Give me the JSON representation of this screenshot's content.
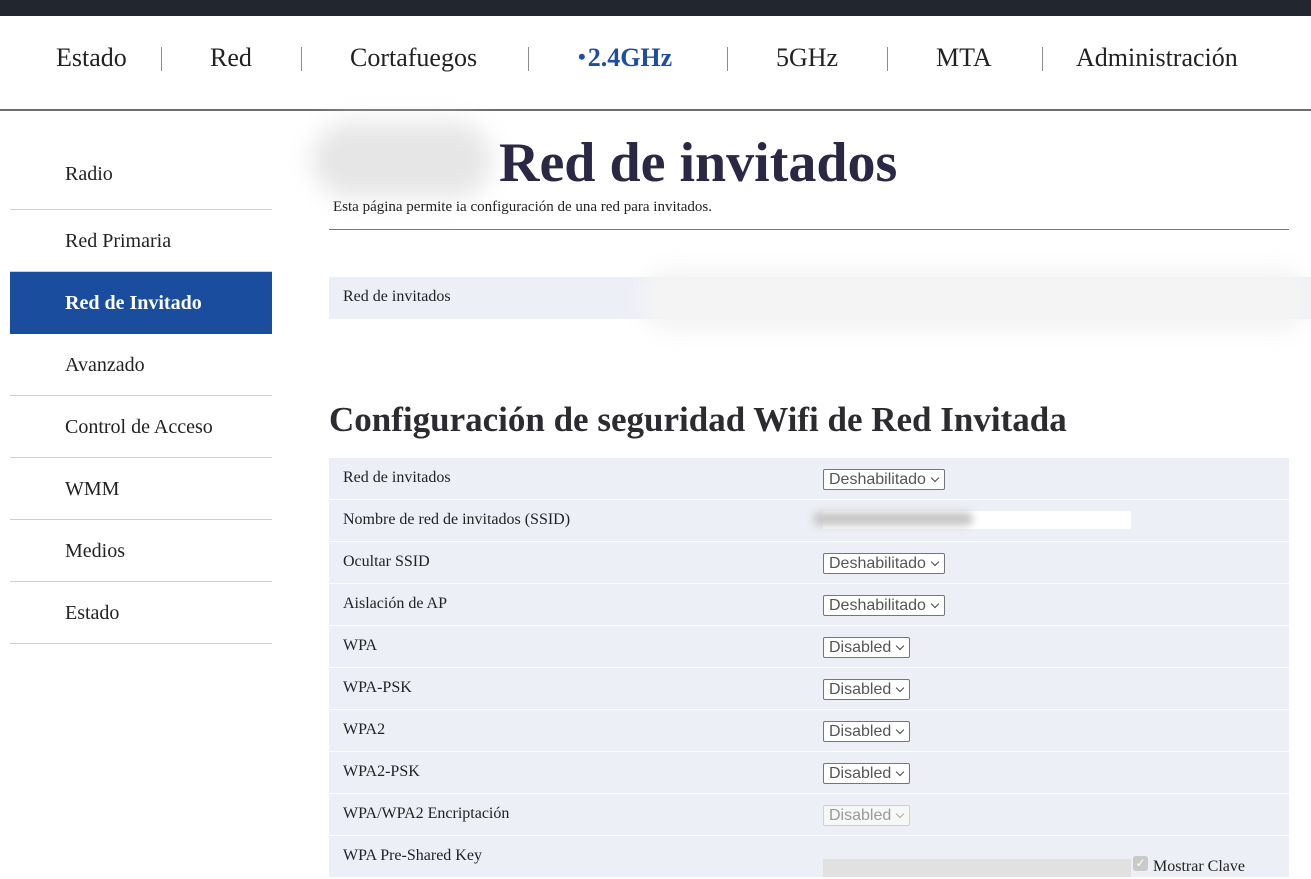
{
  "topnav": {
    "items": [
      {
        "label": "Estado"
      },
      {
        "label": "Red"
      },
      {
        "label": "Cortafuegos"
      },
      {
        "label": "2.4GHz",
        "active": true
      },
      {
        "label": "5GHz"
      },
      {
        "label": "MTA"
      },
      {
        "label": "Administración"
      }
    ],
    "active_marker": "•"
  },
  "sidebar": {
    "items": [
      {
        "label": "Radio"
      },
      {
        "label": "Red Primaria"
      },
      {
        "label": "Red de Invitado",
        "active": true
      },
      {
        "label": "Avanzado"
      },
      {
        "label": "Control de Acceso"
      },
      {
        "label": "WMM"
      },
      {
        "label": "Medios"
      },
      {
        "label": "Estado"
      }
    ]
  },
  "page": {
    "title": "Red de invitados",
    "description": "Esta página permite ia configuración de una red para invitados.",
    "guest_bar_label": "Red de invitados"
  },
  "security": {
    "title": "Configuración de seguridad Wifi de Red Invitada",
    "rows": [
      {
        "label": "Red de invitados",
        "value": "Deshabilitado"
      },
      {
        "label": "Nombre de red de invitados (SSID)"
      },
      {
        "label": "Ocultar SSID",
        "value": "Deshabilitado"
      },
      {
        "label": "Aislación de AP",
        "value": "Deshabilitado"
      },
      {
        "label": "WPA",
        "value": "Disabled"
      },
      {
        "label": "WPA-PSK",
        "value": "Disabled"
      },
      {
        "label": "WPA2",
        "value": "Disabled"
      },
      {
        "label": "WPA2-PSK",
        "value": "Disabled"
      },
      {
        "label": "WPA/WPA2 Encriptación",
        "value": "Disabled",
        "disabled": true
      },
      {
        "label": "WPA Pre-Shared Key"
      }
    ],
    "show_key_label": "Mostrar Clave",
    "show_key_checked": true
  },
  "colors": {
    "accent": "#1a4d9e",
    "active_tab": "#1e4e9e",
    "row_bg": "#edeff6",
    "title": "#2b2845",
    "top_strip": "#22262e"
  }
}
